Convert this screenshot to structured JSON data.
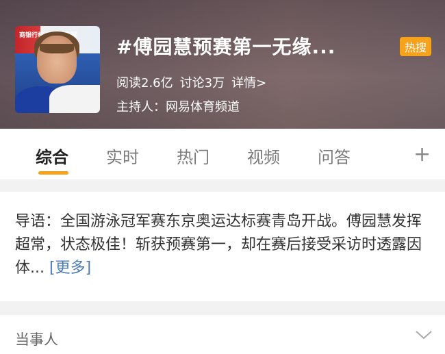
{
  "topic": {
    "title": "#傅园慧预赛第一无缘...",
    "badge": "热搜",
    "read": "阅读2.6亿",
    "discuss": "讨论3万",
    "details": "详情>",
    "host": "主持人：网易体育频道",
    "thumbnail_banner": "商银行杯 全国游泳冠"
  },
  "tabs": {
    "items": [
      {
        "label": "综合"
      },
      {
        "label": "实时"
      },
      {
        "label": "热门"
      },
      {
        "label": "视频"
      },
      {
        "label": "问答"
      }
    ],
    "plus": "+"
  },
  "intro": {
    "text": "导语：全国游泳冠军赛东京奥运达标赛青岛开战。傅园慧发挥超常，状态极佳！斩获预赛第一，却在赛后接受采访时透露因体...",
    "more": "[更多]"
  },
  "party": {
    "label": "当事人"
  },
  "colors": {
    "accent": "#f7a21b",
    "link": "#4a7bb7"
  }
}
